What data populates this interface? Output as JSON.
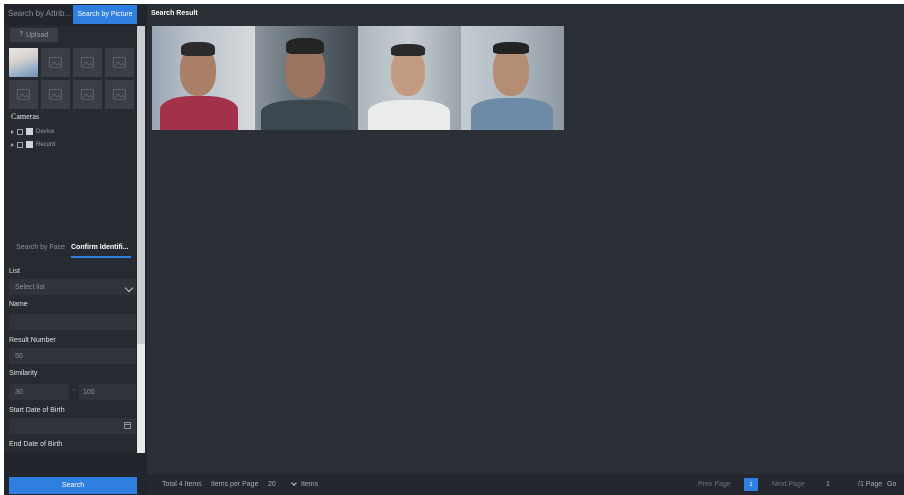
{
  "left_panel": {
    "tabs": {
      "attribute": "Search by Attrib...",
      "picture": "Search by Picture"
    },
    "upload_label": "Upload",
    "cameras_label": "Cameras",
    "tree": [
      {
        "label": "Device"
      },
      {
        "label": "Record"
      }
    ],
    "sub_tabs": {
      "face": "Search by Face",
      "confirm": "Confirm Identifi..."
    },
    "form": {
      "list_label": "List",
      "list_value": "Select list",
      "name_label": "Name",
      "name_value": "",
      "result_number_label": "Result Number",
      "result_number_value": "50",
      "similarity_label": "Similarity",
      "similarity_min": "30",
      "similarity_sep": "-",
      "similarity_max": "100",
      "start_dob_label": "Start Date of Birth",
      "end_dob_label": "End Date of Birth"
    },
    "search_button": "Search"
  },
  "main": {
    "title": "Search Result",
    "results_count": 4
  },
  "footer": {
    "total": "Total 4 Items",
    "per_page_label": "Items per Page",
    "per_page_value": "20",
    "items_label": "Items",
    "prev": "Prev Page",
    "current_page": "1",
    "next": "Next Page",
    "goto_value": "1",
    "page_total": "/1 Page",
    "go": "Go"
  },
  "colors": {
    "accent": "#2f7fe0",
    "background": "#2b2f36",
    "panel": "#22262c"
  }
}
